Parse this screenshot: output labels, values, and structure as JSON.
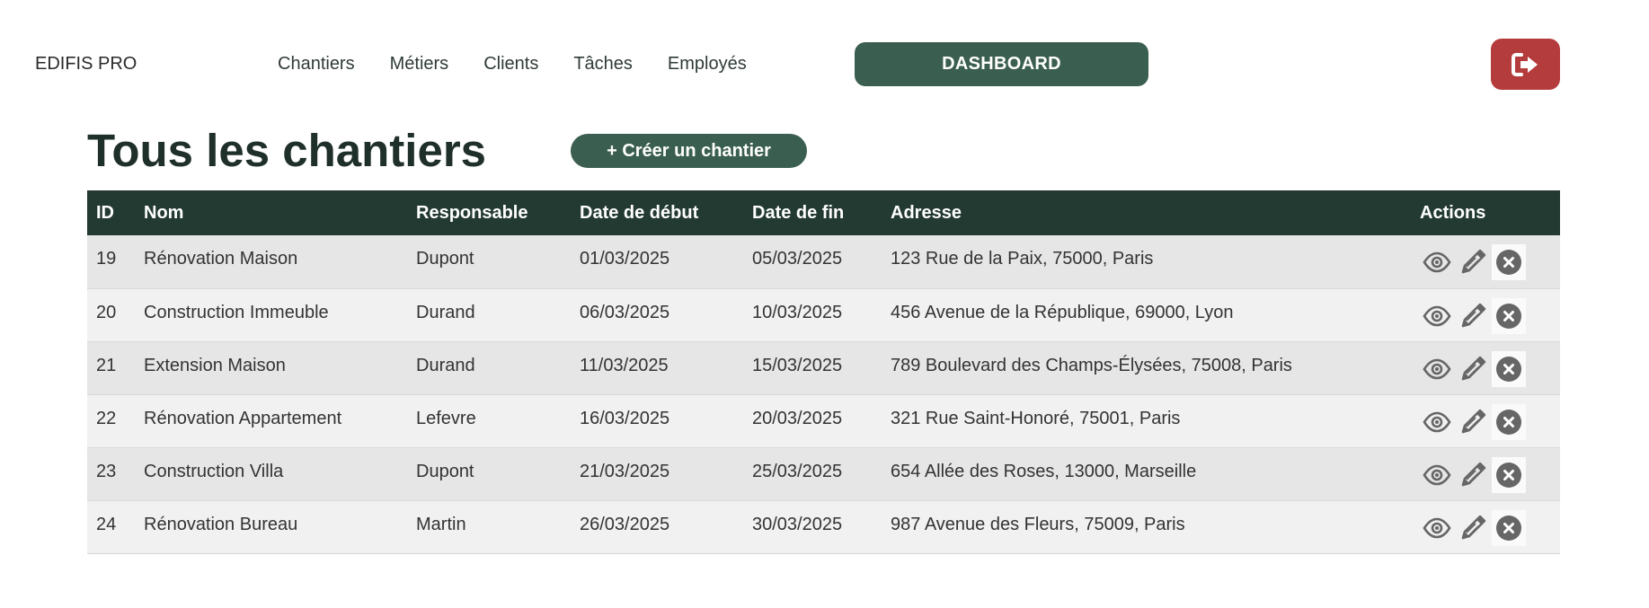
{
  "header": {
    "brand": "EDIFIS PRO",
    "nav": [
      "Chantiers",
      "Métiers",
      "Clients",
      "Tâches",
      "Employés"
    ],
    "dashboard_label": "DASHBOARD",
    "logout_icon": "sign-out-icon"
  },
  "main": {
    "title": "Tous les chantiers",
    "create_label": "+ Créer un chantier"
  },
  "table": {
    "columns": [
      "ID",
      "Nom",
      "Responsable",
      "Date de début",
      "Date de fin",
      "Adresse",
      "Actions"
    ],
    "rows": [
      [
        "19",
        "Rénovation Maison",
        "Dupont",
        "01/03/2025",
        "05/03/2025",
        "123 Rue de la Paix, 75000, Paris"
      ],
      [
        "20",
        "Construction Immeuble",
        "Durand",
        "06/03/2025",
        "10/03/2025",
        "456 Avenue de la République, 69000, Lyon"
      ],
      [
        "21",
        "Extension Maison",
        "Durand",
        "11/03/2025",
        "15/03/2025",
        "789 Boulevard des Champs-Élysées, 75008, Paris"
      ],
      [
        "22",
        "Rénovation Appartement",
        "Lefevre",
        "16/03/2025",
        "20/03/2025",
        "321 Rue Saint-Honoré, 75001, Paris"
      ],
      [
        "23",
        "Construction Villa",
        "Dupont",
        "21/03/2025",
        "25/03/2025",
        "654 Allée des Roses, 13000, Marseille"
      ],
      [
        "24",
        "Rénovation Bureau",
        "Martin",
        "26/03/2025",
        "30/03/2025",
        "987 Avenue des Fleurs, 75009, Paris"
      ]
    ],
    "action_icons": [
      "eye-icon",
      "pencil-icon",
      "close-circle-icon"
    ]
  },
  "colors": {
    "primary_green": "#3a5e4f",
    "header_dark": "#233a32",
    "logout_red": "#b53c3c",
    "icon_gray": "#666666"
  }
}
